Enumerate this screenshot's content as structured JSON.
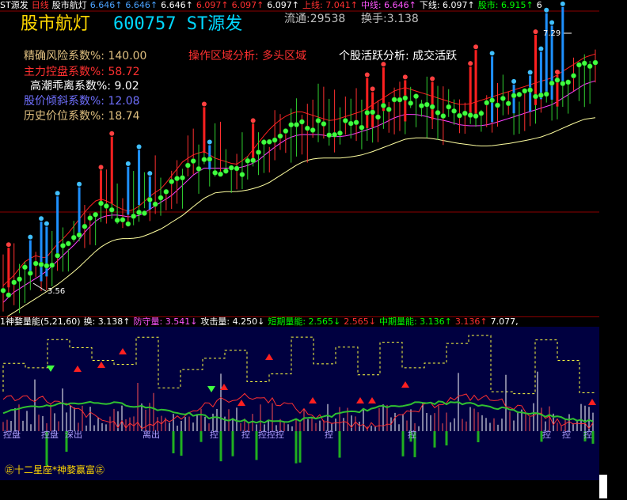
{
  "header": {
    "items": [
      {
        "text": "ST源发",
        "color": "#ffffff"
      },
      {
        "text": "日线",
        "color": "#ff3030"
      },
      {
        "text": "股市航灯",
        "color": "#ffffff"
      },
      {
        "text": "6.646↑",
        "color": "#4aa3ff"
      },
      {
        "text": "6.646↑",
        "color": "#4aa3ff"
      },
      {
        "text": "6.646↑",
        "color": "#ffffff"
      },
      {
        "text": "6.097↑",
        "color": "#ff3030"
      },
      {
        "text": "6.097↑",
        "color": "#ff3030"
      },
      {
        "text": "6.097↑",
        "color": "#ffffff"
      },
      {
        "text": "上线: 7.041↑",
        "color": "#ff3030"
      },
      {
        "text": "中线: 6.646↑",
        "color": "#ff55ff"
      },
      {
        "text": "下线: 6.097↑",
        "color": "#ffffff"
      },
      {
        "text": "股市: 6.915↑",
        "color": "#00ff00"
      },
      {
        "text": "6",
        "color": "#ffffff"
      }
    ],
    "menu_icon_color": "#ffffff"
  },
  "title": {
    "name": "股市航灯",
    "code_name": "600757 ST源发",
    "floating": "流通:29538",
    "turnover": "换手:3.138"
  },
  "metrics": [
    {
      "label": "精确风险系数%: 140.00",
      "color": "#e0c080"
    },
    {
      "label": "主力控盘系数%: 58.72",
      "color": "#ff3030"
    },
    {
      "label": "高潮乖离系数%: 9.02",
      "color": "#ffffff"
    },
    {
      "label": "股价倾斜系数%: 12.08",
      "color": "#7070ff"
    },
    {
      "label": "历史价位系数%: 18.74",
      "color": "#e0c080"
    }
  ],
  "analysis": {
    "operation": "操作区域分析: 多头区域",
    "activity": "个股活跃分析: 成交活跃"
  },
  "chart_data": [
    {
      "type": "line",
      "title": "",
      "xlabel": "",
      "ylabel": "",
      "annotations": [
        "7.29",
        "3.56"
      ],
      "series": [
        {
          "values": [
            3.6,
            3.75,
            3.95,
            4.05,
            4.0,
            4.2,
            4.35,
            4.55,
            4.75,
            4.9,
            4.85,
            4.75,
            4.7,
            4.8,
            4.95,
            5.05,
            5.25,
            5.45,
            5.55,
            5.6,
            5.5,
            5.45,
            5.4,
            5.5,
            5.7,
            5.9,
            6.05,
            6.15,
            6.2,
            6.15,
            6.1,
            6.05,
            6.1,
            6.15,
            6.2,
            6.3,
            6.4,
            6.5,
            6.55,
            6.5,
            6.45,
            6.4,
            6.35,
            6.3,
            6.3,
            6.35,
            6.4,
            6.45,
            6.5,
            6.55,
            6.6,
            6.65,
            6.7,
            6.8,
            6.9,
            7.0,
            7.05
          ]
        },
        {
          "values": [
            3.35,
            3.5,
            3.6,
            3.7,
            3.8,
            3.95,
            4.1,
            4.25,
            4.45,
            4.6,
            4.65,
            4.65,
            4.62,
            4.65,
            4.75,
            4.85,
            4.95,
            5.1,
            5.25,
            5.35,
            5.35,
            5.35,
            5.35,
            5.38,
            5.45,
            5.58,
            5.7,
            5.8,
            5.85,
            5.85,
            5.85,
            5.82,
            5.82,
            5.85,
            5.9,
            5.95,
            6.02,
            6.1,
            6.15,
            6.15,
            6.12,
            6.08,
            6.05,
            6.0,
            5.98,
            5.98,
            6.0,
            6.05,
            6.1,
            6.15,
            6.2,
            6.25,
            6.3,
            6.4,
            6.5,
            6.6,
            6.65
          ]
        },
        {
          "values": [
            3.1,
            3.2,
            3.3,
            3.4,
            3.5,
            3.6,
            3.72,
            3.85,
            4.0,
            4.15,
            4.25,
            4.3,
            4.3,
            4.32,
            4.38,
            4.45,
            4.55,
            4.65,
            4.78,
            4.9,
            4.98,
            5.0,
            5.0,
            5.02,
            5.06,
            5.12,
            5.22,
            5.32,
            5.42,
            5.48,
            5.5,
            5.5,
            5.5,
            5.52,
            5.55,
            5.6,
            5.66,
            5.72,
            5.78,
            5.8,
            5.8,
            5.78,
            5.75,
            5.72,
            5.7,
            5.68,
            5.68,
            5.7,
            5.72,
            5.75,
            5.78,
            5.82,
            5.88,
            5.95,
            6.02,
            6.08,
            6.1
          ]
        }
      ]
    },
    {
      "type": "bar",
      "title": "",
      "xlabel": "",
      "ylabel": ""
    }
  ],
  "lower": {
    "header": [
      {
        "text": "1神婺量能(5,21,60)",
        "color": "#ffffff"
      },
      {
        "text": "换: 3.138↑",
        "color": "#ffffff"
      },
      {
        "text": "防守量: 3.541↓",
        "color": "#ff55ff"
      },
      {
        "text": "攻击量: 4.250↓",
        "color": "#ffffff"
      },
      {
        "text": "短期量能: 2.565↓",
        "color": "#00ff00"
      },
      {
        "text": "2.565↓",
        "color": "#ff3030"
      },
      {
        "text": "中期量能: 3.136↑",
        "color": "#00ff00"
      },
      {
        "text": "3.136↑",
        "color": "#ff3030"
      },
      {
        "text": "7.077,",
        "color": "#ffffff"
      }
    ],
    "tags": [
      {
        "text": "控盘",
        "color": "#b0a0ff"
      },
      {
        "text": "控盘",
        "color": "#b0a0ff"
      },
      {
        "text": "深出",
        "color": "#b0a0ff"
      },
      {
        "text": "离出",
        "color": "#b0a0ff"
      },
      {
        "text": "控",
        "color": "#b0a0ff"
      },
      {
        "text": "控",
        "color": "#b0a0ff"
      },
      {
        "text": "控控控",
        "color": "#b0a0ff"
      },
      {
        "text": "控",
        "color": "#b0a0ff"
      },
      {
        "text": "控",
        "color": "#b0a0ff"
      },
      {
        "text": "控",
        "color": "#b0a0ff"
      },
      {
        "text": "控",
        "color": "#b0a0ff"
      },
      {
        "text": "控",
        "color": "#b0a0ff"
      }
    ],
    "footer": "㊣十二星座*神婺赢富㊣"
  },
  "colors": {
    "up": "#ff3030",
    "down": "#00ff00",
    "background": "#000000",
    "lower_bg": "#000040",
    "grid": "#8b0000"
  }
}
